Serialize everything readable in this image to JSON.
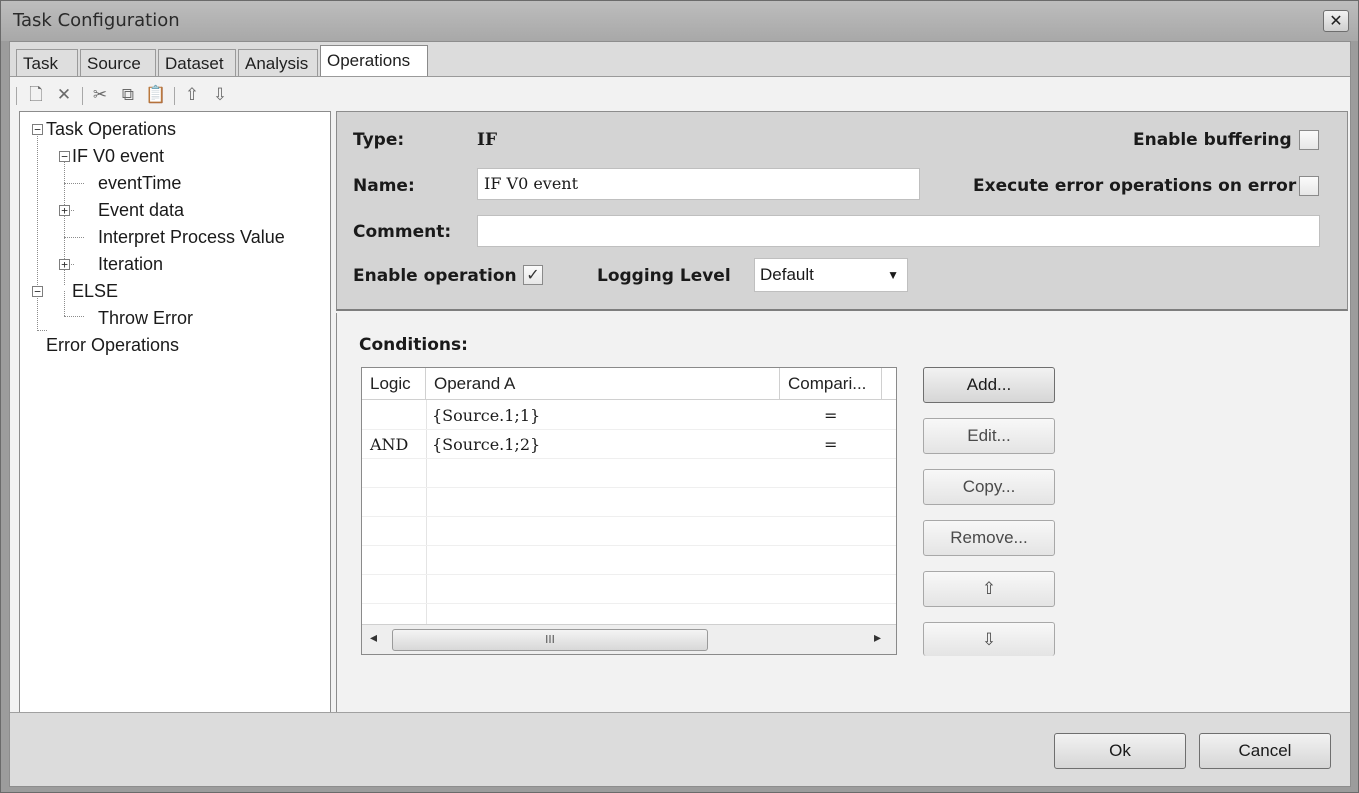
{
  "window": {
    "title": "Task Configuration",
    "close_glyph": "✕"
  },
  "tabs": [
    {
      "label": "Task"
    },
    {
      "label": "Source"
    },
    {
      "label": "Dataset"
    },
    {
      "label": "Analysis"
    },
    {
      "label": "Operations",
      "active": true
    }
  ],
  "toolbar": {
    "icons": [
      "new-icon",
      "delete-icon",
      "cut-icon",
      "copy-icon",
      "paste-icon",
      "move-up-icon",
      "move-down-icon"
    ],
    "glyphs": {
      "new": "🗋",
      "delete": "✕",
      "cut": "✂",
      "copy": "⧉",
      "paste": "📋",
      "up": "⇧",
      "down": "⇩"
    }
  },
  "tree": {
    "expanded_glyph": "−",
    "collapsed_glyph": "+",
    "items": [
      {
        "label": "Task Operations"
      },
      {
        "label": "IF V0 event"
      },
      {
        "label": "eventTime"
      },
      {
        "label": "Event data"
      },
      {
        "label": "Interpret Process Value"
      },
      {
        "label": "Iteration"
      },
      {
        "label": "ELSE"
      },
      {
        "label": "Throw Error"
      },
      {
        "label": "Error Operations"
      }
    ]
  },
  "properties": {
    "type_label": "Type:",
    "type_value": "IF",
    "name_label": "Name:",
    "name_value": "IF V0 event",
    "comment_label": "Comment:",
    "comment_value": "",
    "enable_operation_label": "Enable operation",
    "enable_operation_checked": true,
    "logging_level_label": "Logging Level",
    "logging_level_value": "Default",
    "enable_buffering_label": "Enable buffering",
    "enable_buffering_checked": false,
    "execute_error_label": "Execute error operations on error",
    "execute_error_checked": false,
    "check_glyph": "✓",
    "dropdown_glyph": "▼"
  },
  "conditions": {
    "label": "Conditions:",
    "columns": [
      "Logic",
      "Operand A",
      "Compari..."
    ],
    "rows": [
      {
        "logic": "",
        "operand_a": "{Source.1;1}",
        "comparison": "="
      },
      {
        "logic": "AND",
        "operand_a": "{Source.1;2}",
        "comparison": "="
      }
    ],
    "scroll_left_glyph": "◂",
    "scroll_right_glyph": "▸",
    "scroll_thumb_glyph": "III"
  },
  "condition_buttons": {
    "add": "Add...",
    "edit": "Edit...",
    "copy": "Copy...",
    "remove": "Remove...",
    "up_glyph": "⇧",
    "down_glyph": "⇩"
  },
  "footer": {
    "ok": "Ok",
    "cancel": "Cancel"
  }
}
